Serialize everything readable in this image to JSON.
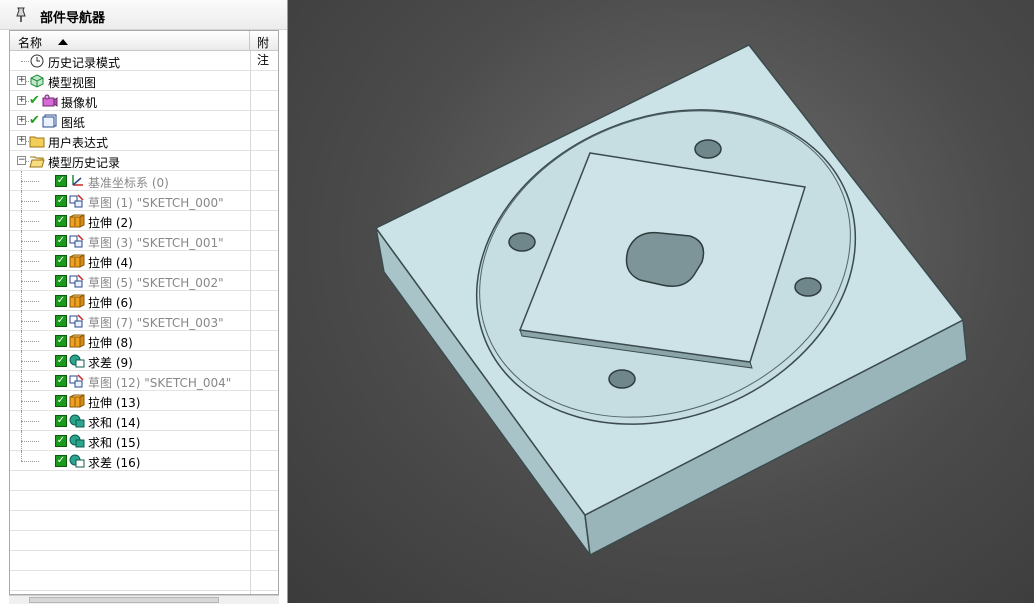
{
  "navigator": {
    "title": "部件导航器",
    "columns": {
      "name": "名称",
      "notes": "附注"
    }
  },
  "tree": [
    {
      "label": "历史记录模式",
      "icon": "clock-icon",
      "depth": 0,
      "expander": null,
      "checked": false,
      "tick": false,
      "grey": false
    },
    {
      "label": "模型视图",
      "icon": "model-view-icon",
      "depth": 0,
      "expander": "+",
      "checked": false,
      "tick": false,
      "grey": false
    },
    {
      "label": "摄像机",
      "icon": "camera-icon",
      "depth": 0,
      "expander": "+",
      "checked": false,
      "tick": true,
      "grey": false
    },
    {
      "label": "图纸",
      "icon": "drawing-sheet-icon",
      "depth": 0,
      "expander": "+",
      "checked": false,
      "tick": true,
      "grey": false
    },
    {
      "label": "用户表达式",
      "icon": "folder-icon",
      "depth": 0,
      "expander": "+",
      "checked": false,
      "tick": false,
      "grey": false
    },
    {
      "label": "模型历史记录",
      "icon": "folder-open-icon",
      "depth": 0,
      "expander": "−",
      "checked": false,
      "tick": false,
      "grey": false
    },
    {
      "label": "基准坐标系 (0)",
      "icon": "datum-csys-icon",
      "depth": 1,
      "expander": null,
      "checked": true,
      "tick": false,
      "grey": true
    },
    {
      "label": "草图 (1) \"SKETCH_000\"",
      "icon": "sketch-icon",
      "depth": 1,
      "expander": null,
      "checked": true,
      "tick": false,
      "grey": true
    },
    {
      "label": "拉伸 (2)",
      "icon": "extrude-icon",
      "depth": 1,
      "expander": null,
      "checked": true,
      "tick": false,
      "grey": false
    },
    {
      "label": "草图 (3) \"SKETCH_001\"",
      "icon": "sketch-icon",
      "depth": 1,
      "expander": null,
      "checked": true,
      "tick": false,
      "grey": true
    },
    {
      "label": "拉伸 (4)",
      "icon": "extrude-icon",
      "depth": 1,
      "expander": null,
      "checked": true,
      "tick": false,
      "grey": false
    },
    {
      "label": "草图 (5) \"SKETCH_002\"",
      "icon": "sketch-icon",
      "depth": 1,
      "expander": null,
      "checked": true,
      "tick": false,
      "grey": true
    },
    {
      "label": "拉伸 (6)",
      "icon": "extrude-icon",
      "depth": 1,
      "expander": null,
      "checked": true,
      "tick": false,
      "grey": false
    },
    {
      "label": "草图 (7) \"SKETCH_003\"",
      "icon": "sketch-icon",
      "depth": 1,
      "expander": null,
      "checked": true,
      "tick": false,
      "grey": true
    },
    {
      "label": "拉伸 (8)",
      "icon": "extrude-icon",
      "depth": 1,
      "expander": null,
      "checked": true,
      "tick": false,
      "grey": false
    },
    {
      "label": "求差 (9)",
      "icon": "subtract-icon",
      "depth": 1,
      "expander": null,
      "checked": true,
      "tick": false,
      "grey": false
    },
    {
      "label": "草图 (12) \"SKETCH_004\"",
      "icon": "sketch-icon",
      "depth": 1,
      "expander": null,
      "checked": true,
      "tick": false,
      "grey": true
    },
    {
      "label": "拉伸 (13)",
      "icon": "extrude-icon",
      "depth": 1,
      "expander": null,
      "checked": true,
      "tick": false,
      "grey": false
    },
    {
      "label": "求和 (14)",
      "icon": "unite-icon",
      "depth": 1,
      "expander": null,
      "checked": true,
      "tick": false,
      "grey": false
    },
    {
      "label": "求和 (15)",
      "icon": "unite-icon",
      "depth": 1,
      "expander": null,
      "checked": true,
      "tick": false,
      "grey": false
    },
    {
      "label": "求差 (16)",
      "icon": "subtract-icon",
      "depth": 1,
      "expander": null,
      "checked": true,
      "tick": false,
      "grey": false
    }
  ],
  "colors": {
    "part_face_top": "#c9e1e5",
    "part_face_side": "#a7c2c6",
    "part_edge": "#3b4b4d",
    "check_green": "#1a9a1a"
  }
}
